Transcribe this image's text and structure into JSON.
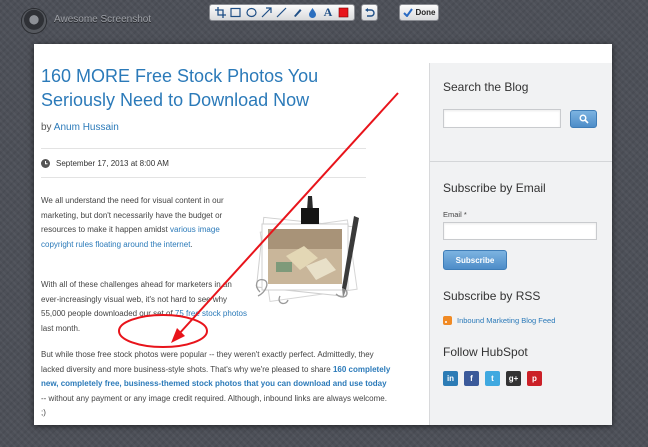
{
  "app": {
    "title": "Awesome Screenshot"
  },
  "toolbar": {
    "tools": [
      "crop-icon",
      "rectangle-icon",
      "ellipse-icon",
      "arrow-icon",
      "line-icon",
      "pen-icon",
      "blur-icon",
      "text-icon",
      "color-swatch-icon"
    ],
    "text_tool_label": "A",
    "done_label": "Done",
    "accent_color": "#e8141b"
  },
  "article": {
    "title": "160 MORE Free Stock Photos You Seriously Need to Download Now",
    "byline_prefix": "by",
    "author": "Anum Hussain",
    "date": "September 17, 2013 at 8:00 AM",
    "para1_text": "We all understand the need for visual content in our marketing, but don't necessarily have the budget or resources to make it happen amidst",
    "para1_link": "various image copyright rules floating around the internet",
    "para1_end": ".",
    "para2_text": "With all of these challenges ahead for marketers in an ever-increasingly visual web, it's not hard to see why 55,000 people downloaded our set of",
    "para2_link": "75 free stock photos",
    "para2_end": "last month.",
    "para3_text": "But while those free stock photos were popular -- they weren't exactly perfect. Admittedly, they lacked diversity and more business-style shots. That's why we're pleased to share",
    "para3_link": "160 completely new, completely free, business-themed stock photos that you can download and use today",
    "para3_end": "-- without any payment or any image credit required. Although, inbound links are always welcome. ;)"
  },
  "sidebar": {
    "search_title": "Search the Blog",
    "subscribe_email_title": "Subscribe by Email",
    "email_label": "Email *",
    "subscribe_button": "Subscribe",
    "subscribe_rss_title": "Subscribe by RSS",
    "rss_link": "Inbound Marketing Blog Feed",
    "follow_title": "Follow HubSpot",
    "social": [
      {
        "name": "linkedin-icon",
        "glyph": "in",
        "color": "#2c7cb5"
      },
      {
        "name": "facebook-icon",
        "glyph": "f",
        "color": "#3b5a9a"
      },
      {
        "name": "twitter-icon",
        "glyph": "t",
        "color": "#3fa9e0"
      },
      {
        "name": "google-plus-icon",
        "glyph": "g+",
        "color": "#333333"
      },
      {
        "name": "pinterest-icon",
        "glyph": "p",
        "color": "#cb2027"
      }
    ]
  },
  "colors": {
    "link": "#2b7ab9",
    "annotation": "#e8141b",
    "button": "#5a98d0"
  }
}
